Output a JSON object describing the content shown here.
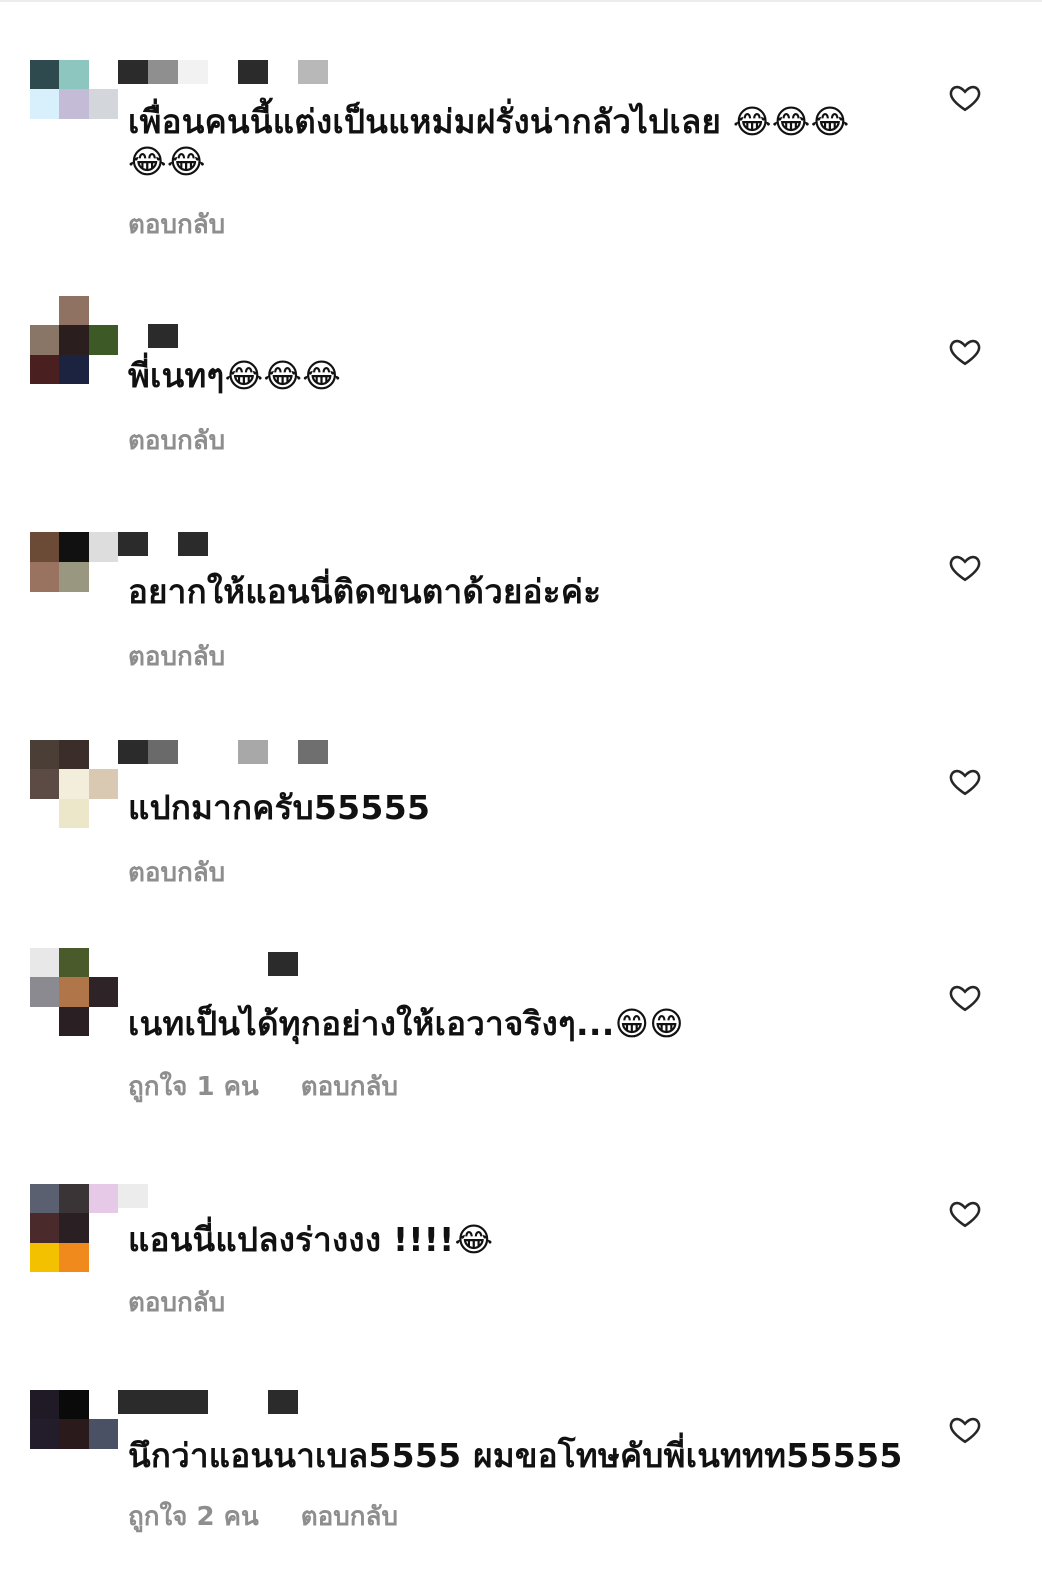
{
  "comments": [
    {
      "text": "เพื่อนคนนี้แต่งเป็นแหม่มฝรั่งน่ากลัวไปเลย 😂😂😂😂😂",
      "likes": "",
      "reply": "ตอบกลับ",
      "avatar_colors": [
        "#2e4a4f",
        "#8cc6be",
        "#ffffff",
        "#d8f0fb",
        "#c4bcd6",
        "#d3d6da",
        "#ffffff",
        "#ffffff",
        "#ffffff"
      ],
      "name_colors": [
        "#2b2b2b",
        "#8f8f8f",
        "#f2f2f2",
        "#ffffff",
        "#2b2b2b",
        "#ffffff",
        "#b8b8b8"
      ]
    },
    {
      "text": "พี่เนทๆ😂😂😂",
      "likes": "",
      "reply": "ตอบกลับ",
      "avatar_colors": [
        "#ffffff",
        "#8f7261",
        "#ffffff",
        "#8a7666",
        "#2b1e1e",
        "#3d5a26",
        "#4a1f1f",
        "#1c2340",
        "#ffffff"
      ],
      "name_colors": [
        "#ffffff",
        "#2b2b2b",
        "#ffffff",
        "#ffffff",
        "#ffffff",
        "#ffffff",
        "#ffffff"
      ]
    },
    {
      "text": "อยากให้แอนนี่ติดขนตาด้วยอ่ะค่ะ",
      "likes": "",
      "reply": "ตอบกลับ",
      "avatar_colors": [
        "#6b4a36",
        "#111111",
        "#dddddd",
        "#9a7360",
        "#9a9780",
        "#ffffff",
        "#ffffff",
        "#ffffff",
        "#ffffff"
      ],
      "name_colors": [
        "#2b2b2b",
        "#ffffff",
        "#2b2b2b",
        "#ffffff",
        "#ffffff",
        "#ffffff",
        "#ffffff"
      ]
    },
    {
      "text": "แปกมากครับ55555",
      "likes": "",
      "reply": "ตอบกลับ",
      "avatar_colors": [
        "#4a3e37",
        "#3b2e2a",
        "#ffffff",
        "#5c4b45",
        "#f3eedc",
        "#d9c9b2",
        "#ffffff",
        "#ece7c8",
        "#ffffff"
      ],
      "name_colors": [
        "#2b2b2b",
        "#6a6a6a",
        "#ffffff",
        "#ffffff",
        "#a8a8a8",
        "#ffffff",
        "#6f6f6f"
      ]
    },
    {
      "text": "เนทเป็นได้ทุกอย่างให้เอวาจริงๆ...😁😁",
      "likes": "ถูกใจ 1 คน",
      "reply": "ตอบกลับ",
      "avatar_colors": [
        "#e8e8e8",
        "#4a5a2a",
        "#ffffff",
        "#8a8a90",
        "#b0764a",
        "#2e2428",
        "#ffffff",
        "#2a2024",
        "#ffffff"
      ],
      "name_colors": [
        "#ffffff",
        "#ffffff",
        "#ffffff",
        "#ffffff",
        "#ffffff",
        "#2b2b2b",
        "#ffffff"
      ]
    },
    {
      "text": "แอนนี่แปลงร่างงง !!!!😂",
      "likes": "",
      "reply": "ตอบกลับ",
      "avatar_colors": [
        "#5a6070",
        "#3b3436",
        "#e6c9e6",
        "#4a2a2a",
        "#2a2024",
        "#ffffff",
        "#f3c100",
        "#f08a1c",
        "#ffffff"
      ],
      "name_colors": [
        "#ececec",
        "#ffffff",
        "#ffffff",
        "#ffffff",
        "#ffffff",
        "#ffffff",
        "#ffffff"
      ]
    },
    {
      "text": "นึกว่าแอนนาเบล5555 ผมขอโทษคับพี่เนททท55555",
      "likes": "ถูกใจ 2 คน",
      "reply": "ตอบกลับ",
      "avatar_colors": [
        "#1f1a26",
        "#0a0a0a",
        "#ffffff",
        "#231d2b",
        "#2a1a1c",
        "#4b5164",
        "#ffffff",
        "#ffffff",
        "#ffffff"
      ],
      "name_colors": [
        "#2b2b2b",
        "#2b2b2b",
        "#2b2b2b",
        "#ffffff",
        "#ffffff",
        "#2b2b2b",
        "#ffffff"
      ]
    }
  ]
}
